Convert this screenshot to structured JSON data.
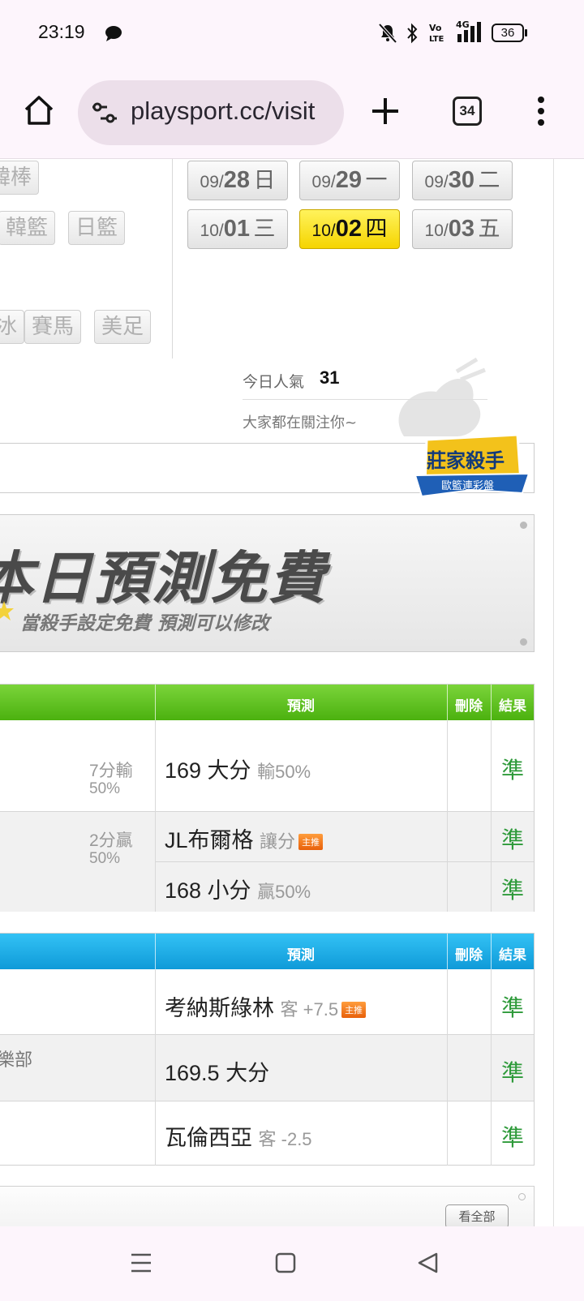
{
  "status_bar": {
    "time": "23:19",
    "battery": "36"
  },
  "browser": {
    "url": "playsport.cc/visit",
    "tab_count": "34"
  },
  "sport_tags": [
    "韓棒",
    "韓籃",
    "日籃",
    "冰",
    "賽馬",
    "美足"
  ],
  "dates": [
    {
      "month": "09/",
      "day": "28",
      "weekday": "日"
    },
    {
      "month": "09/",
      "day": "29",
      "weekday": "一"
    },
    {
      "month": "09/",
      "day": "30",
      "weekday": "二"
    },
    {
      "month": "10/",
      "day": "01",
      "weekday": "三"
    },
    {
      "month": "10/",
      "day": "02",
      "weekday": "四"
    },
    {
      "month": "10/",
      "day": "03",
      "weekday": "五"
    }
  ],
  "popularity": {
    "label": "今日人氣",
    "value": "31",
    "note": "大家都在關注你~"
  },
  "killer_badge": {
    "line1": "莊家殺手",
    "line2": "歐籃連彩盤"
  },
  "banner": {
    "title": "本日預測免費",
    "subtitle": "當殺手設定免費 預測可以修改"
  },
  "table_headers": {
    "prediction": "預測",
    "delete": "刪除",
    "result": "結果"
  },
  "table1": {
    "rows": [
      {
        "left": "7分輸",
        "left2": "50%",
        "pred": "169 大分",
        "pred_sub": "輸50%",
        "badge": "",
        "result": "準"
      },
      {
        "left": "2分贏",
        "left2": "50%",
        "pred": "JL布爾格",
        "pred_sub": "讓分",
        "badge": "主推",
        "result": "準"
      },
      {
        "left": "",
        "left2": "",
        "pred": "168 小分",
        "pred_sub": "贏50%",
        "badge": "",
        "result": "準"
      }
    ]
  },
  "table2": {
    "rows": [
      {
        "left": "",
        "pred": "考納斯綠林",
        "pred_sub": "客 +7.5",
        "badge": "主推",
        "result": "準"
      },
      {
        "left": "樂部",
        "pred": "169.5 大分",
        "pred_sub": "",
        "badge": "",
        "result": "準"
      },
      {
        "left": "",
        "pred": "瓦倫西亞",
        "pred_sub": "客 -2.5",
        "badge": "",
        "result": "準"
      }
    ]
  },
  "view_all": "看全部",
  "colors": {
    "green_header": "#5cc21c",
    "blue_header": "#17a9e6",
    "active_date": "#ffe500",
    "result_green": "#2e9a3a"
  }
}
